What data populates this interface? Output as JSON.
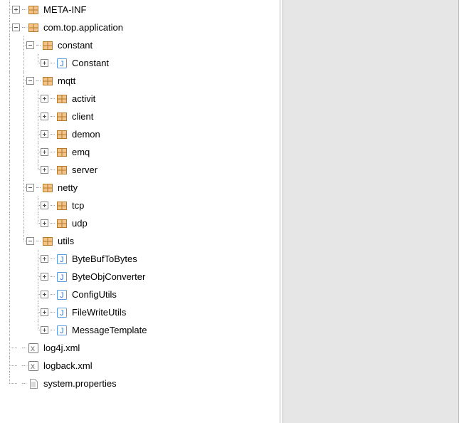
{
  "tree": {
    "meta_inf": {
      "label": "META-INF"
    },
    "app_pkg": {
      "label": "com.top.application"
    },
    "constant": {
      "label": "constant"
    },
    "constant_cls": {
      "label": "Constant"
    },
    "mqtt": {
      "label": "mqtt"
    },
    "mqtt_activit": {
      "label": "activit"
    },
    "mqtt_client": {
      "label": "client"
    },
    "mqtt_demon": {
      "label": "demon"
    },
    "mqtt_emq": {
      "label": "emq"
    },
    "mqtt_server": {
      "label": "server"
    },
    "netty": {
      "label": "netty"
    },
    "netty_tcp": {
      "label": "tcp"
    },
    "netty_udp": {
      "label": "udp"
    },
    "utils": {
      "label": "utils"
    },
    "utils_bbtb": {
      "label": "ByteBufToBytes"
    },
    "utils_boc": {
      "label": "ByteObjConverter"
    },
    "utils_cfg": {
      "label": "ConfigUtils"
    },
    "utils_fw": {
      "label": "FileWriteUtils"
    },
    "utils_mt": {
      "label": "MessageTemplate"
    },
    "log4j": {
      "label": "log4j.xml"
    },
    "logback": {
      "label": "logback.xml"
    },
    "sysprops": {
      "label": "system.properties"
    }
  }
}
